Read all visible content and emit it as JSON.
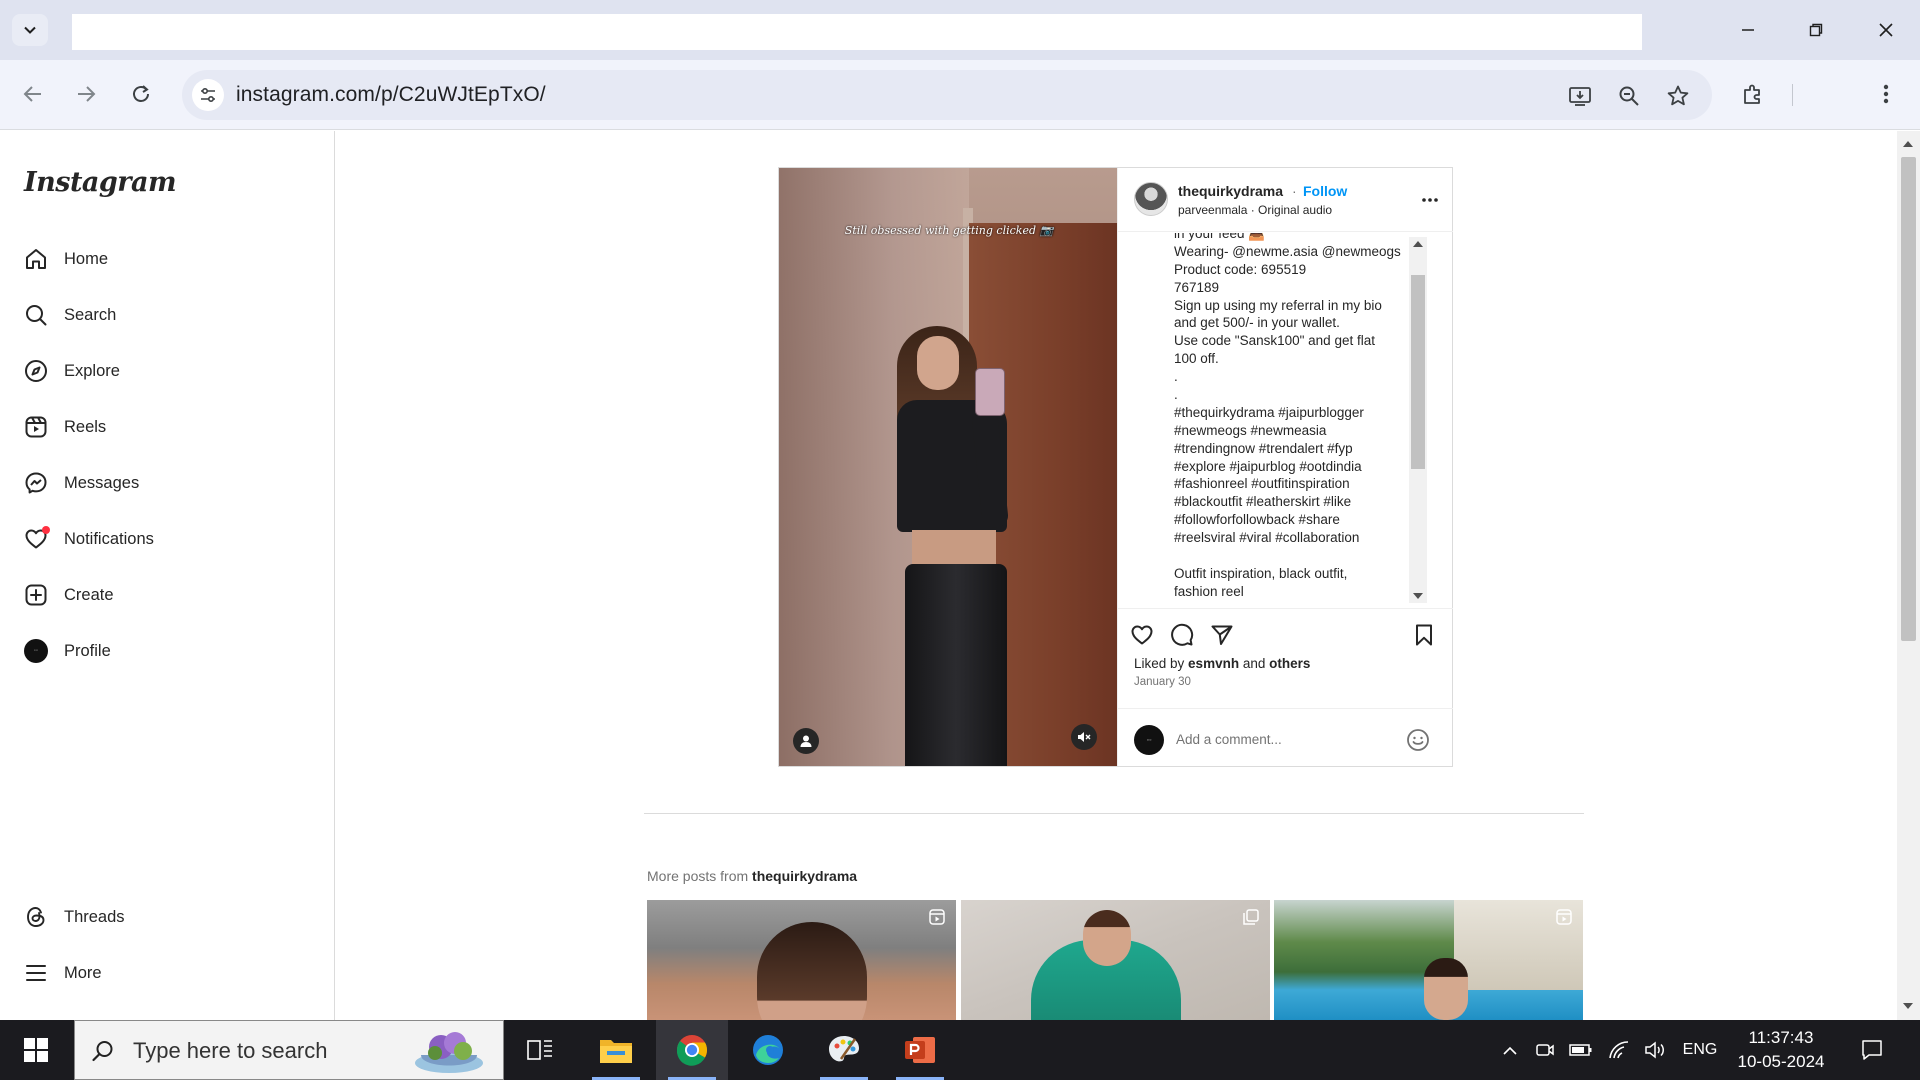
{
  "browser": {
    "url": "instagram.com/p/C2uWJtEpTxO/"
  },
  "sidebar": {
    "logo": "Instagram",
    "nav": [
      {
        "label": "Home",
        "icon": "home-icon"
      },
      {
        "label": "Search",
        "icon": "search-icon"
      },
      {
        "label": "Explore",
        "icon": "compass-icon"
      },
      {
        "label": "Reels",
        "icon": "reels-icon"
      },
      {
        "label": "Messages",
        "icon": "messenger-icon"
      },
      {
        "label": "Notifications",
        "icon": "heart-icon"
      },
      {
        "label": "Create",
        "icon": "plus-square-icon"
      },
      {
        "label": "Profile",
        "icon": "avatar"
      }
    ],
    "bottom": [
      {
        "label": "Threads",
        "icon": "threads-icon"
      },
      {
        "label": "More",
        "icon": "hamburger-icon"
      }
    ]
  },
  "post": {
    "username": "thequirkydrama",
    "dot": "·",
    "follow_label": "Follow",
    "subtitle": "parveenmala · Original audio",
    "media_caption": "Still obsessed with getting clicked 📷",
    "caption_lines": [
      "in your feed 📤",
      "Wearing- @newme.asia @newmeogs",
      "Product code: 695519",
      "767189",
      "Sign up using my referral in my bio",
      "and get 500/- in your wallet.",
      "Use code \"Sansk100\" and get flat",
      "100 off.",
      ".",
      ".",
      "#thequirkydrama #jaipurblogger",
      "#newmeogs #newmeasia",
      "#trendingnow #trendalert #fyp",
      "#explore #jaipurblog #ootdindia",
      "#fashionreel #outfitinspiration",
      "#blackoutfit #leatherskirt #like",
      "#followforfollowback #share",
      "#reelsviral #viral #collaboration",
      "",
      "Outfit inspiration, black outfit,",
      "fashion reel"
    ],
    "liked_prefix": "Liked by ",
    "liked_user": "esmvnh",
    "liked_and": " and ",
    "liked_others": "others",
    "date": "January 30",
    "comment_placeholder": "Add a comment..."
  },
  "more_posts": {
    "prefix": "More posts from ",
    "username": "thequirkydrama"
  },
  "taskbar": {
    "search_placeholder": "Type here to search",
    "language": "ENG",
    "time": "11:37:43",
    "date": "10-05-2024"
  },
  "colors": {
    "accent_blue": "#0095f6",
    "notification_dot": "#ff3040",
    "taskbar": "#1b1b1f"
  }
}
